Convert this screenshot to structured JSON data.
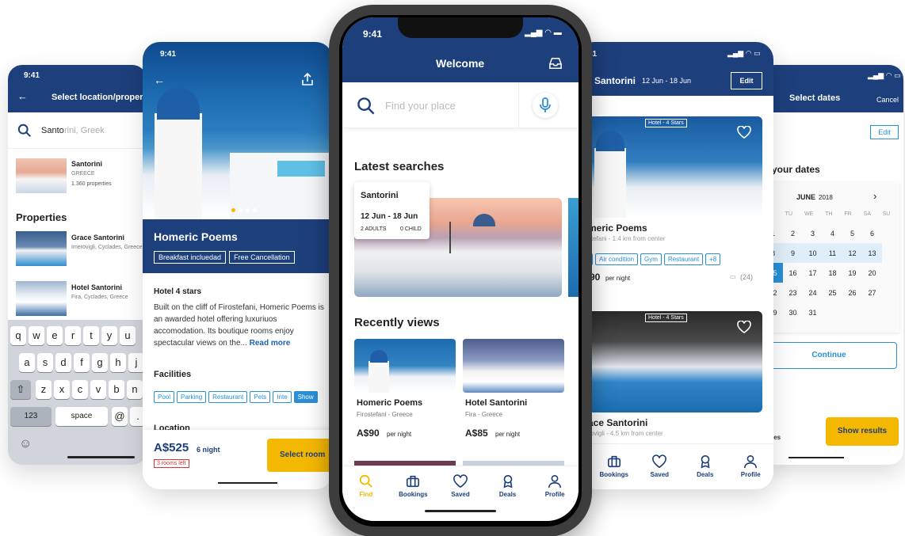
{
  "left_phone": {
    "time": "9:41",
    "title": "Select location/proper",
    "search_typed": "Santo",
    "search_hint": "rini, Greek",
    "location": {
      "name": "Santorini",
      "country": "GREECE",
      "count": "1.360 properties"
    },
    "properties_heading": "Properties",
    "properties": [
      {
        "name": "Grace Santorini",
        "place": "Imerovigli, Cyclades, Greece"
      },
      {
        "name": "Hotel Santorini",
        "place": "Fira, Cyclades, Greece"
      }
    ],
    "keyboard": {
      "row1": [
        "q",
        "w",
        "e",
        "r",
        "t",
        "y",
        "u"
      ],
      "row2": [
        "a",
        "s",
        "d",
        "f",
        "g",
        "h",
        "j"
      ],
      "row3": [
        "z",
        "x",
        "c",
        "v",
        "b",
        "n"
      ],
      "num": "123",
      "space": "space",
      "at": "@",
      "dot": "."
    }
  },
  "hotel_phone": {
    "time": "9:41",
    "hotel_name": "Homeric Poems",
    "badges": [
      "Breakfast incluedad",
      "Free Cancellation"
    ],
    "stars": "Hotel 4 stars",
    "description": "Built on the cliff of Firostefani, Homeric Poems is an awarded hotel offering luxuriuos accomodation. Its boutique rooms enjoy spectacular views on the...",
    "read_more": "Read more",
    "facilities_heading": "Facilities",
    "facilities": [
      "Pool",
      "Parking",
      "Restaurant",
      "Pets",
      "Inte",
      "Show"
    ],
    "location_heading": "Location",
    "price": "A$525",
    "price_unit": "6 night",
    "rooms_left": "3 rooms left",
    "select_label": "Select room"
  },
  "main_phone": {
    "time": "9:41",
    "title": "Welcome",
    "search_placeholder": "Find your place",
    "latest_heading": "Latest searches",
    "latest_card": {
      "city": "Santorini",
      "dates": "12 Jun - 18 Jun",
      "adults": "2 ADULTS",
      "child": "0 CHILD"
    },
    "recent_heading": "Recently views",
    "recent": [
      {
        "name": "Homeric Poems",
        "place": "Firostefani - Greece",
        "price": "A$90",
        "unit": "per night"
      },
      {
        "name": "Hotel Santorini",
        "place": "Fira - Greece",
        "price": "A$85",
        "unit": "per night"
      }
    ],
    "tabs": [
      "Find",
      "Bookings",
      "Saved",
      "Deals",
      "Profile"
    ]
  },
  "results_phone": {
    "time": "41",
    "title": "Santorini",
    "dates": "12 Jun - 18 Jun",
    "edit_label": "Edit",
    "cards": [
      {
        "badge": "Hotel - 4 Stars",
        "name": "meric Poems",
        "distance": "stefani - 1.4 km from center",
        "tags": [
          "",
          "Air condition",
          "Gym",
          "Restaurant",
          "+8"
        ],
        "price": "90",
        "unit": "per night",
        "reviews": "(24)"
      },
      {
        "badge": "Hotel - 4 Stars",
        "name": "ace Santorini",
        "distance": "rovigli - 4.5 km from center"
      }
    ],
    "tabs": [
      "Bookings",
      "Saved",
      "Deals",
      "Profile"
    ]
  },
  "dates_phone": {
    "title": "Select dates",
    "cancel_label": "Cancel",
    "edit_label": "Edit",
    "heading": "your dates",
    "month": "JUNE",
    "year": "2018",
    "weekdays": [
      "M",
      "TU",
      "WE",
      "TH",
      "FR",
      "SA",
      "SU"
    ],
    "weeks": [
      [
        "1",
        "2",
        "3",
        "4",
        "5",
        "6"
      ],
      [
        "8",
        "9",
        "10",
        "11",
        "12",
        "13"
      ],
      [
        "15",
        "16",
        "17",
        "18",
        "19",
        "20"
      ],
      [
        "22",
        "23",
        "24",
        "25",
        "26",
        "27"
      ],
      [
        "29",
        "30",
        "31"
      ]
    ],
    "continue_label": "Continue",
    "show_results_label": "Show results",
    "side_label": "ies"
  },
  "colors": {
    "navy": "#1d3f7c",
    "accent": "#f5b800",
    "link": "#2a8fd6"
  }
}
